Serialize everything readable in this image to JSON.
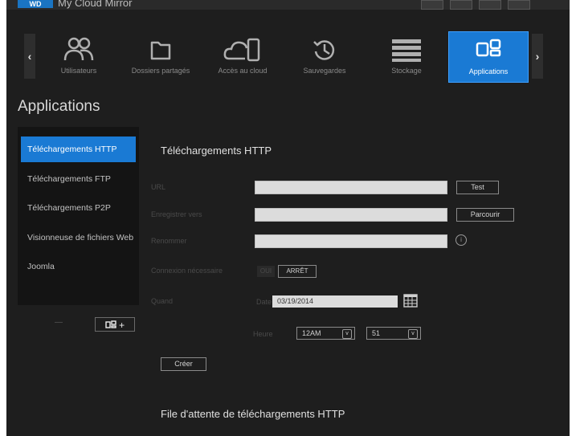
{
  "app": {
    "logo_text": "WD",
    "title": "My Cloud Mirror"
  },
  "nav": {
    "items": [
      {
        "label": "Utilisateurs",
        "icon": "users-icon"
      },
      {
        "label": "Dossiers partagés",
        "icon": "folder-icon"
      },
      {
        "label": "Accès au cloud",
        "icon": "cloud-device-icon"
      },
      {
        "label": "Sauvegardes",
        "icon": "history-icon"
      },
      {
        "label": "Stockage",
        "icon": "storage-icon"
      },
      {
        "label": "Applications",
        "icon": "apps-icon"
      }
    ],
    "active": "Applications",
    "prev_glyph": "‹",
    "next_glyph": "›"
  },
  "page_title": "Applications",
  "sidebar": {
    "items": [
      {
        "label": "Téléchargements HTTP"
      },
      {
        "label": "Téléchargements FTP"
      },
      {
        "label": "Téléchargements P2P"
      },
      {
        "label": "Visionneuse de fichiers Web"
      },
      {
        "label": "Joomla"
      }
    ],
    "active": "Téléchargements HTTP",
    "remove_label": "—",
    "add_label": "+"
  },
  "main": {
    "section_title": "Téléchargements HTTP",
    "url_label": "URL",
    "url_value": "",
    "test_button": "Test",
    "save_to_label": "Enregistrer vers",
    "save_to_value": "",
    "browse_button": "Parcourir",
    "rename_label": "Renommer",
    "rename_value": "",
    "login_label": "Connexion nécessaire",
    "toggle_on": "OUI",
    "toggle_off": "ARRÊT",
    "when_label": "Quand",
    "date_label": "Date",
    "date_value": "03/19/2014",
    "time_label": "Heure",
    "hour_value": "12AM",
    "minute_value": "51",
    "create_button": "Créer",
    "queue_title": "File d'attente de téléchargements HTTP"
  },
  "colors": {
    "accent": "#1a7ad4",
    "background": "#1e1e1e",
    "sidebar_bg": "#141414"
  }
}
